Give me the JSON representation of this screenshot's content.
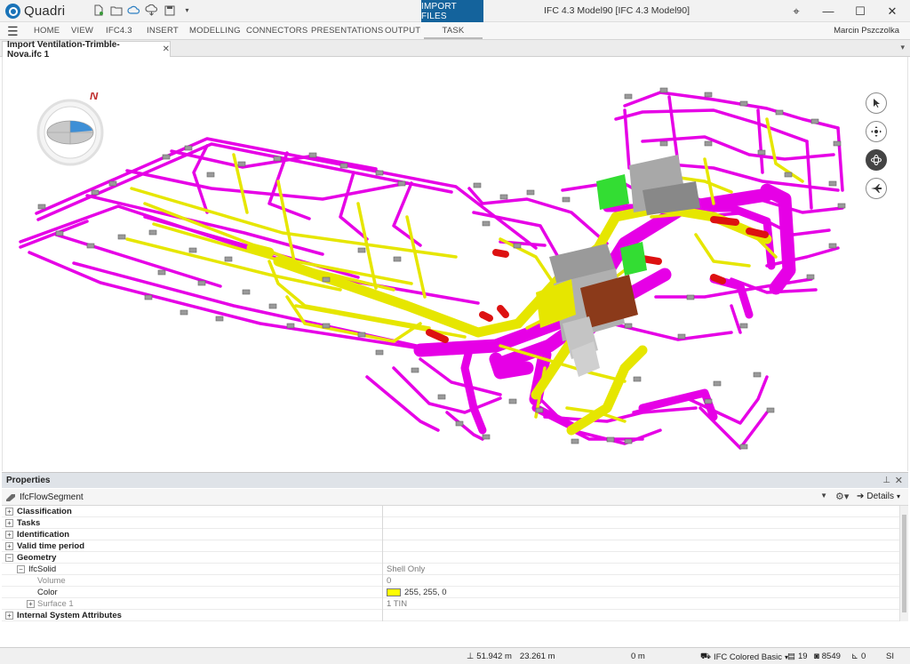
{
  "app": {
    "name": "Quadri",
    "window_title": "IFC 4.3 Model90  [IFC 4.3 Model90]"
  },
  "titlebar": {
    "import_tab": "IMPORT FILES",
    "quick_access": [
      "new-file-icon",
      "open-folder-icon",
      "cloud-icon",
      "cloud-sync-icon",
      "save-icon",
      "dropdown-arrow-icon"
    ],
    "minimize": "—",
    "maximize": "☐",
    "close": "✕",
    "pin": "⌖"
  },
  "ribbon": {
    "tabs": [
      "HOME",
      "VIEW",
      "IFC4.3",
      "INSERT",
      "MODELLING",
      "CONNECTORS",
      "PRESENTATIONS",
      "OUTPUT",
      "TASK"
    ],
    "active_tab": "TASK",
    "user": "Marcin Pszczolka"
  },
  "document": {
    "tab_title": "Import Ventilation-Trimble-Nova.ifc 1",
    "close": "✕"
  },
  "viewport": {
    "compass_label": "N",
    "nav_tools": [
      "select-pointer-icon",
      "pan-icon",
      "orbit-icon",
      "fly-icon"
    ],
    "colors": {
      "supply": "#e600e6",
      "return": "#e6e600",
      "equipment": "#a8a8a8",
      "unit": "#8b3a1a",
      "fan": "#33dd33",
      "damper": "#dd1111"
    }
  },
  "properties": {
    "title": "Properties",
    "pin": "📌",
    "close": "✕",
    "selected": "IfcFlowSegment",
    "details_label": "Details",
    "rows": [
      {
        "label": "Classification",
        "value": "",
        "kind": "cat",
        "exp": "+"
      },
      {
        "label": "Tasks",
        "value": "",
        "kind": "cat",
        "exp": "+"
      },
      {
        "label": "Identification",
        "value": "",
        "kind": "cat",
        "exp": "+"
      },
      {
        "label": "Valid time period",
        "value": "",
        "kind": "cat",
        "exp": "+"
      },
      {
        "label": "Geometry",
        "value": "",
        "kind": "cat",
        "exp": "−"
      },
      {
        "label": "IfcSolid",
        "value": "Shell Only",
        "kind": "sub",
        "exp": "−"
      },
      {
        "label": "Volume",
        "value": "0",
        "kind": "dim",
        "exp": ""
      },
      {
        "label": "Color",
        "value": "255, 255, 0",
        "kind": "sub",
        "exp": ""
      },
      {
        "label": "Surface 1",
        "value": "1 TIN",
        "kind": "dim",
        "exp": "+"
      },
      {
        "label": "Internal System Attributes",
        "value": "",
        "kind": "cat",
        "exp": "+"
      }
    ]
  },
  "statusbar": {
    "x_coord": "51.942 m",
    "y_coord": "23.261 m",
    "elevation": "0 m",
    "style": "IFC Colored Basic",
    "count_a": "19",
    "count_b": "8549",
    "count_c": "0",
    "units": "SI"
  }
}
